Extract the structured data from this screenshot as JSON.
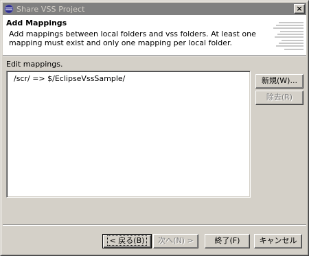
{
  "window": {
    "title": "Share VSS Project",
    "close_glyph": "×"
  },
  "header": {
    "title": "Add Mappings",
    "description": "Add mappings between local folders and vss folders. At least one mapping must exist and only one mapping per local folder."
  },
  "mappings": {
    "label": "Edit mappings.",
    "items": [
      {
        "text": "/scr/  =>  $/EclipseVssSample/"
      }
    ]
  },
  "side_buttons": {
    "new_label": "新規(W)...",
    "remove_label": "除去(R)"
  },
  "footer_buttons": {
    "back_label": "< 戻る(B)",
    "next_label": "次へ(N) >",
    "finish_label": "終了(F)",
    "cancel_label": "キャンセル"
  },
  "colors": {
    "titlebar_inactive": "#808080",
    "dialog_face": "#d4d0c8",
    "header_background": "#ffffff"
  },
  "icons": {
    "app": "eclipse-icon",
    "close": "close-icon",
    "banner": "wizard-banner-icon"
  }
}
